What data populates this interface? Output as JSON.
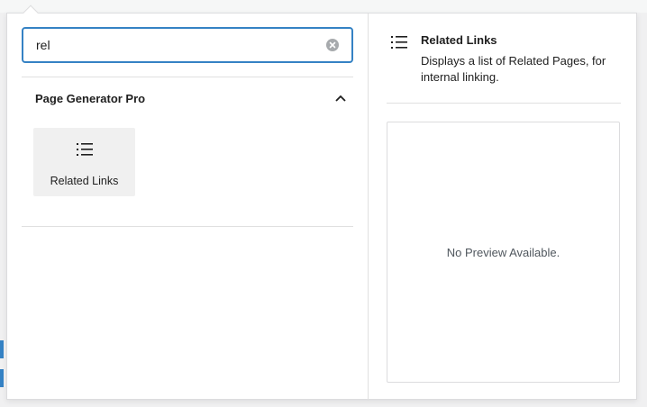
{
  "search": {
    "value": "rel",
    "clear_icon": "clear-circle-icon"
  },
  "category": {
    "title": "Page Generator Pro",
    "toggle_icon": "chevron-up-icon"
  },
  "blocks": [
    {
      "label": "Related Links",
      "icon": "list-icon"
    }
  ],
  "detail": {
    "icon": "list-icon",
    "title": "Related Links",
    "description": "Displays a list of Related Pages, for internal linking."
  },
  "preview": {
    "empty_text": "No Preview Available."
  },
  "colors": {
    "accent": "#3582c4",
    "tile_bg": "#f0f0f0",
    "border": "#dcdcde"
  }
}
